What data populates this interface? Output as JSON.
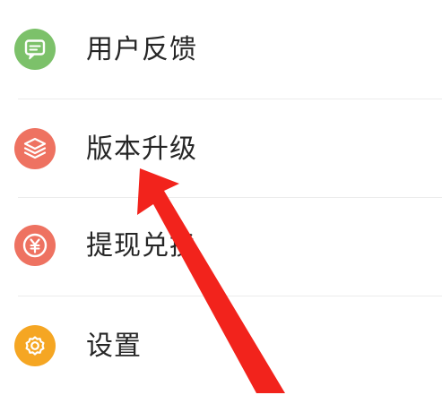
{
  "menu": {
    "items": [
      {
        "label": "用户反馈",
        "icon": "feedback-icon",
        "color": "#7cc16a"
      },
      {
        "label": "版本升级",
        "icon": "layers-icon",
        "color": "#ee7261"
      },
      {
        "label": "提现兑换",
        "icon": "yuan-icon",
        "color": "#ee7261"
      },
      {
        "label": "设置",
        "icon": "gear-icon",
        "color": "#f5a623"
      }
    ]
  },
  "annotation": {
    "icon": "red-arrow-icon",
    "color": "#f2231c"
  }
}
